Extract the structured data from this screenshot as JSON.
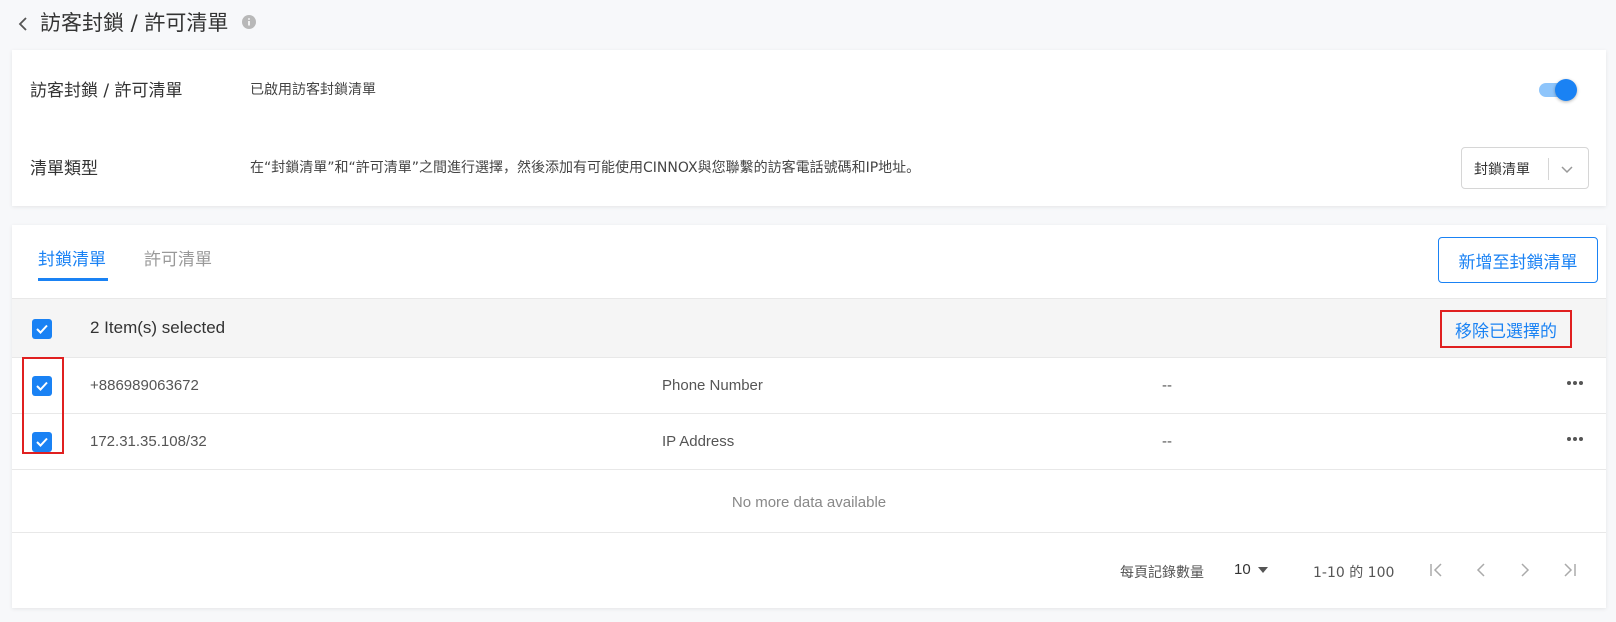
{
  "header": {
    "title": "訪客封鎖 / 許可清單"
  },
  "settings": {
    "enable_label": "訪客封鎖 / 許可清單",
    "enable_desc": "已啟用訪客封鎖清單",
    "toggle_on": true,
    "list_type_label": "清單類型",
    "list_type_desc": "在“封鎖清單”和“許可清單”之間進行選擇，然後添加有可能使用CINNOX與您聯繫的訪客電話號碼和IP地址。",
    "list_type_selected": "封鎖清單"
  },
  "tabs": [
    {
      "label": "封鎖清單",
      "active": true
    },
    {
      "label": "許可清單",
      "active": false
    }
  ],
  "add_button_label": "新增至封鎖清單",
  "selection": {
    "count_text": "2 Item(s) selected",
    "remove_label": "移除已選擇的"
  },
  "rows": [
    {
      "value": "+886989063672",
      "type": "Phone Number",
      "note": "--",
      "checked": true
    },
    {
      "value": "172.31.35.108/32",
      "type": "IP Address",
      "note": "--",
      "checked": true
    }
  ],
  "empty_text": "No more data available",
  "pagination": {
    "per_page_label": "每頁記錄數量",
    "per_page_value": "10",
    "range_text": "1-10 的 100"
  },
  "colors": {
    "accent": "#1a82f4",
    "highlight": "#e02020"
  }
}
